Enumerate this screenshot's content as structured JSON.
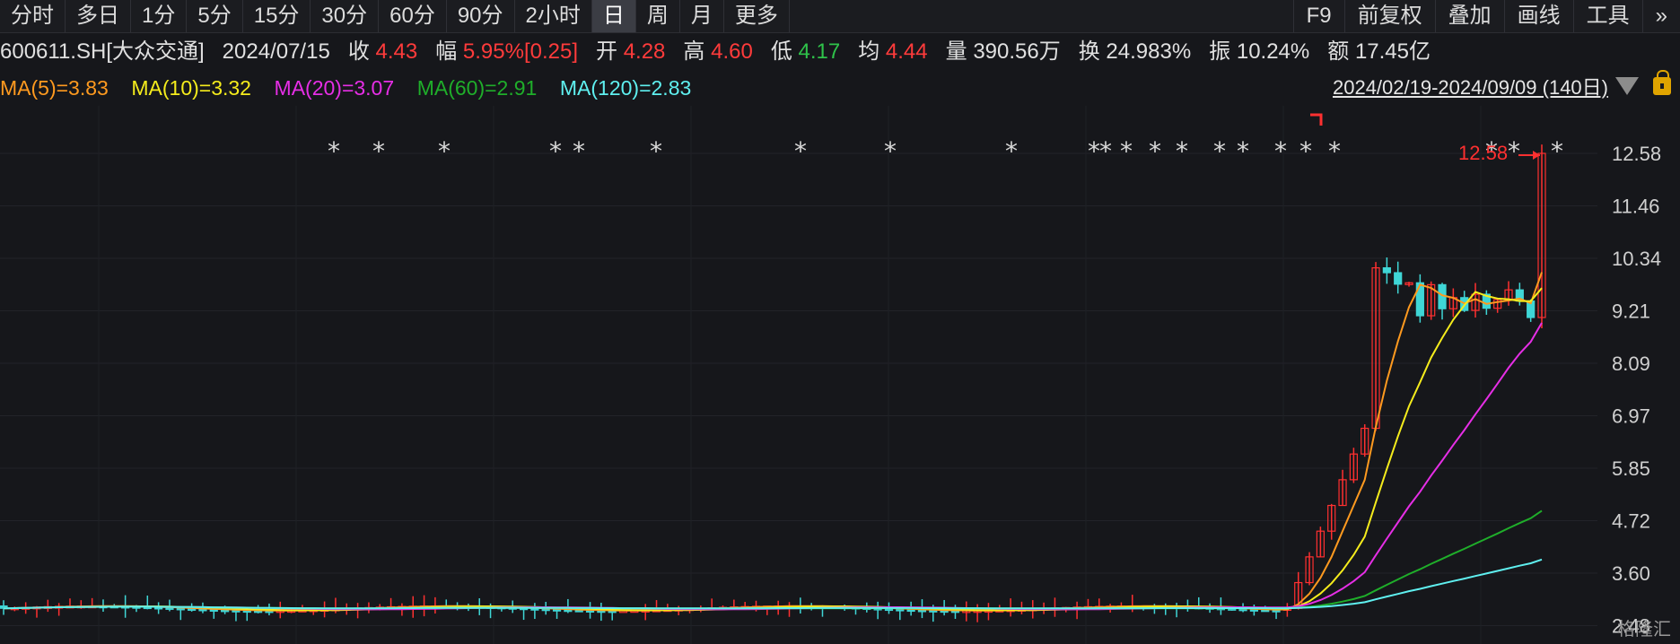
{
  "tabs": [
    {
      "label": "分时",
      "active": false
    },
    {
      "label": "多日",
      "active": false
    },
    {
      "label": "1分",
      "active": false
    },
    {
      "label": "5分",
      "active": false
    },
    {
      "label": "15分",
      "active": false
    },
    {
      "label": "30分",
      "active": false
    },
    {
      "label": "60分",
      "active": false
    },
    {
      "label": "90分",
      "active": false
    },
    {
      "label": "2小时",
      "active": false
    },
    {
      "label": "日",
      "active": true
    },
    {
      "label": "周",
      "active": false
    },
    {
      "label": "月",
      "active": false
    },
    {
      "label": "更多",
      "active": false
    }
  ],
  "right_tabs": [
    "F9",
    "前复权",
    "叠加",
    "画线",
    "工具",
    "»"
  ],
  "quote": {
    "symbol": "600611.SH[大众交通]",
    "date": "2024/07/15",
    "close_label": "收",
    "close": "4.43",
    "change_label": "幅",
    "change": "5.95%[0.25]",
    "open_label": "开",
    "open": "4.28",
    "high_label": "高",
    "high": "4.60",
    "low_label": "低",
    "low": "4.17",
    "avg_label": "均",
    "avg": "4.44",
    "volume_label": "量",
    "volume": "390.56万",
    "turnover_label": "换",
    "turnover": "24.983%",
    "amplitude_label": "振",
    "amplitude": "10.24%",
    "amount_label": "额",
    "amount": "17.45亿"
  },
  "ma": [
    {
      "label": "MA(5)=3.83",
      "color": "#ff9a1f"
    },
    {
      "label": "MA(10)=3.32",
      "color": "#f5ec1c"
    },
    {
      "label": "MA(20)=3.07",
      "color": "#e62ee6"
    },
    {
      "label": "MA(60)=2.91",
      "color": "#1fae2a"
    },
    {
      "label": "MA(120)=2.83",
      "color": "#5ff0f0"
    }
  ],
  "date_range": "2024/02/19-2024/09/09 (140日)",
  "y_ticks": [
    "12.58",
    "11.46",
    "10.34",
    "9.21",
    "8.09",
    "6.97",
    "5.85",
    "4.72",
    "3.60",
    "2.48"
  ],
  "max_label": "12.58",
  "watermark": "格隆汇",
  "colors": {
    "up": "#ff3030",
    "down": "#3fd6d6",
    "bg": "#16171b"
  }
}
